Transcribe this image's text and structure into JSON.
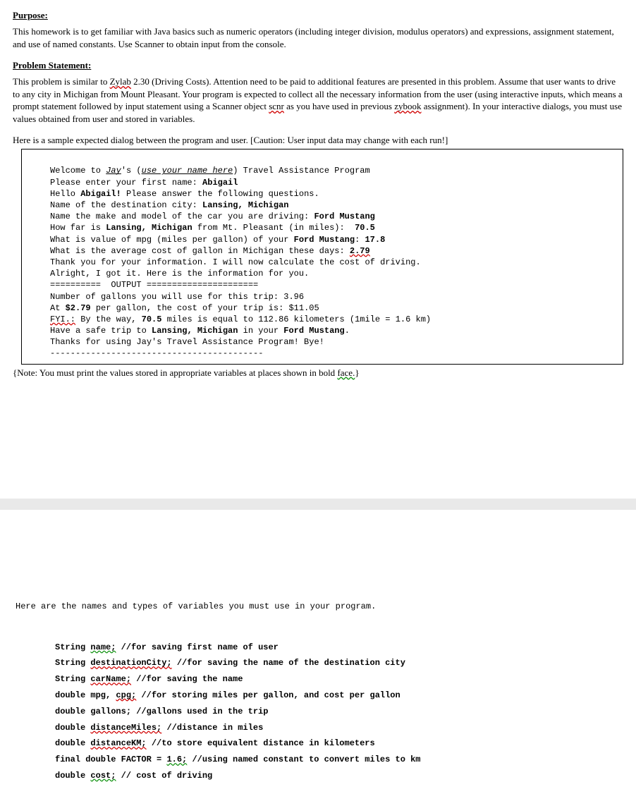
{
  "headings": {
    "purpose": "Purpose:",
    "problem": "Problem Statement:"
  },
  "purpose_text": "This homework is to get familiar with Java basics such as numeric operators (including integer division, modulus operators) and expressions, assignment statement, and use of named constants.  Use Scanner to obtain input from the console.",
  "problem_text_a": "This problem is similar to ",
  "problem_zylab": "Zylab",
  "problem_text_b": " 2.30 (Driving Costs). Attention need to be paid to additional features are presented in this problem. Assume that user wants to drive to any city in Michigan from Mount Pleasant. Your program is expected to collect all the necessary information from the user (using interactive inputs, which means a prompt statement followed by input statement using a Scanner object ",
  "problem_scnr": "scnr",
  "problem_text_c": " as you have used in previous ",
  "problem_zybook": "zybook",
  "problem_text_d": " assignment). In your interactive dialogs, you must use values obtained from user and stored in variables.",
  "caution": "Here is a sample expected dialog between the program and user. [Caution: User input data may change with each run!]",
  "dialog": {
    "l1a": "Welcome to ",
    "l1_jay": "Jay",
    "l1b": "'s (",
    "l1_hint": "use your name here",
    "l1c": ") Travel Assistance Program",
    "l2a": "Please enter your first name: ",
    "l2b": "Abigail",
    "l3a": "Hello ",
    "l3b": "Abigail!",
    "l3c": " Please answer the following questions.",
    "l4a": "Name of the destination city: ",
    "l4b": "Lansing, Michigan",
    "l5a": "Name the make and model of the car you are driving: ",
    "l5b": "Ford Mustang",
    "l6a": "How far is ",
    "l6b": "Lansing, Michigan",
    "l6c": " from Mt. Pleasant (in miles):  ",
    "l6d": "70.5",
    "l7a": "What is value of mpg (miles per gallon) of your ",
    "l7b": "Ford Mustang",
    "l7c": ": ",
    "l7d": "17.8",
    "l8a": "What is the average cost of gallon in Michigan these days: ",
    "l8b": "2.79",
    "l9": "Thank you for your information. I will now calculate the cost of driving.",
    "l10": "Alright, I got it. Here is the information for you.",
    "l11": "==========  OUTPUT ======================",
    "l12": "Number of gallons you will use for this trip: 3.96",
    "l13a": "At ",
    "l13b": "$2.79",
    "l13c": " per gallon, the cost of your trip is: $11.05",
    "l14a": "FYI.:",
    "l14b": " By the way, ",
    "l14c": "70.5",
    "l14d": " miles is equal to 112.86 kilometers (1mile = 1.6 km)",
    "l15a": "Have a safe trip to ",
    "l15b": "Lansing, Michigan",
    "l15c": " in your ",
    "l15d": "Ford Mustang",
    "l15e": ".",
    "l16": "Thanks for using Jay's Travel Assistance Program! Bye!",
    "l17": "------------------------------------------"
  },
  "note_a": "{Note: You must print the values stored in appropriate variables at places shown in bold ",
  "note_b": "face.",
  "note_c": "}",
  "vars_intro": "Here are the names and types of variables you must use in your program.",
  "vars": {
    "v1a": "String ",
    "v1b": "name;",
    "v1c": " //for saving first name of user",
    "v2a": "String ",
    "v2b": "destinationCity;",
    "v2c": " //for saving the name of the destination city",
    "v3a": "String ",
    "v3b": "carName;",
    "v3c": " //for saving the name",
    "v4a": "double mpg, ",
    "v4b": "cpg;",
    "v4c": " //for storing miles per gallon, and cost per gallon",
    "v5": "double gallons; //gallons used in the trip",
    "v6a": "double ",
    "v6b": "distanceMiles;",
    "v6c": " //distance in miles",
    "v7a": "double ",
    "v7b": "distanceKM;",
    "v7c": " //to store equivalent distance in kilometers",
    "v8a": "final double FACTOR = ",
    "v8b": "1.6;",
    "v8c": " //using named constant to convert miles to km",
    "v9a": "double ",
    "v9b": "cost;",
    "v9c": " // cost of driving"
  }
}
